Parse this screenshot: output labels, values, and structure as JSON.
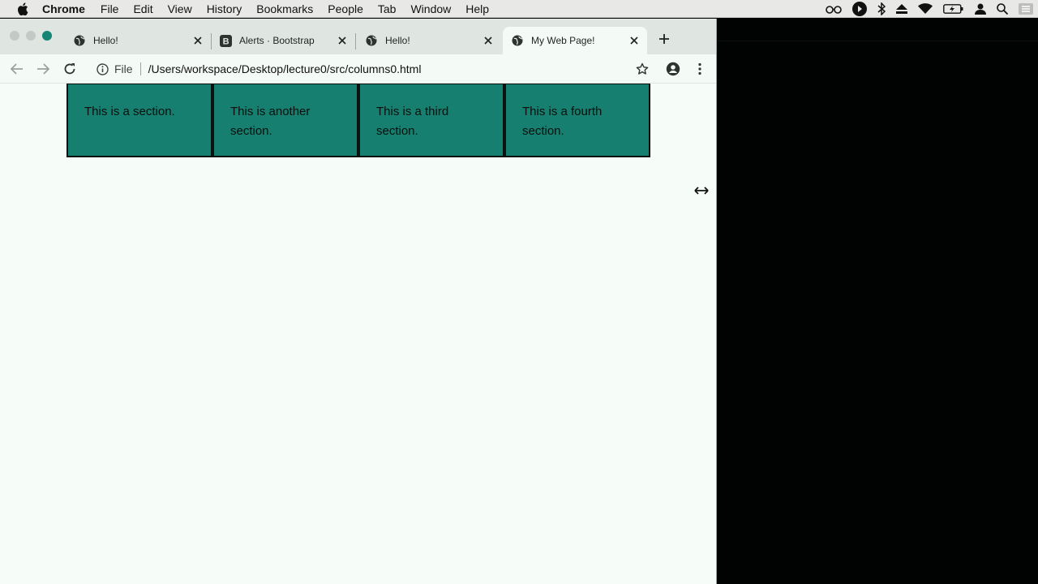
{
  "menubar": {
    "app": "Chrome",
    "items": [
      "File",
      "Edit",
      "View",
      "History",
      "Bookmarks",
      "People",
      "Tab",
      "Window",
      "Help"
    ],
    "status_icons": [
      "glasses-icon",
      "play-circle-icon",
      "bluetooth-icon",
      "eject-icon",
      "wifi-icon",
      "battery-icon",
      "user-icon",
      "search-icon",
      "menu-list-icon"
    ]
  },
  "tabs": [
    {
      "title": "Hello!",
      "favicon": "globe-icon",
      "active": false
    },
    {
      "title": "Alerts · Bootstrap",
      "favicon": "bootstrap-icon",
      "active": false
    },
    {
      "title": "Hello!",
      "favicon": "globe-icon",
      "active": false
    },
    {
      "title": "My Web Page!",
      "favicon": "globe-icon",
      "active": true
    }
  ],
  "toolbar": {
    "scheme": "File",
    "url": "/Users/workspace/Desktop/lecture0/src/columns0.html"
  },
  "page": {
    "sections": [
      {
        "text": "This is a section."
      },
      {
        "text": "This is another section."
      },
      {
        "text": "This is a third section."
      },
      {
        "text": "This is a fourth section."
      }
    ]
  },
  "colors": {
    "section_bg": "#177f6f",
    "page_bg": "#f6fcf8",
    "accent": "#178575"
  }
}
